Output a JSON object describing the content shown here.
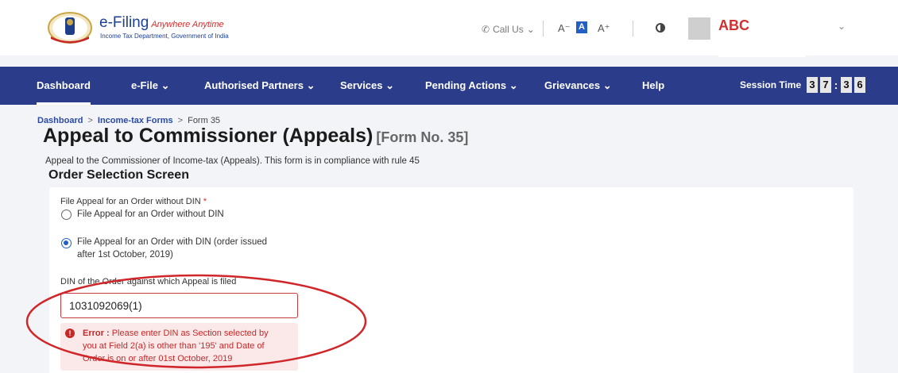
{
  "header": {
    "brand_title": "e-Filing",
    "brand_tagline": "Anywhere Anytime",
    "brand_subtitle": "Income Tax Department, Government of India",
    "call_us": "Call Us",
    "font_small": "A⁻",
    "font_normal": "A",
    "font_large": "A⁺",
    "username": "ABC"
  },
  "nav": {
    "items": [
      {
        "label": "Dashboard"
      },
      {
        "label": "e-File ⌄"
      },
      {
        "label": "Authorised Partners ⌄"
      },
      {
        "label": "Services ⌄"
      },
      {
        "label": "Pending Actions ⌄"
      },
      {
        "label": "Grievances ⌄"
      },
      {
        "label": "Help"
      }
    ],
    "session_label": "Session Time",
    "session_digits": [
      "3",
      "7",
      ":",
      "3",
      "6"
    ]
  },
  "breadcrumb": {
    "items": [
      "Dashboard",
      "Income-tax Forms",
      "Form 35"
    ]
  },
  "page": {
    "title": "Appeal to Commissioner (Appeals)",
    "form_no": "[Form No. 35]",
    "description": "Appeal to the Commissioner of Income-tax (Appeals). This form is in compliance with rule 45",
    "section_title": "Order Selection Screen"
  },
  "form": {
    "question_label": "File Appeal for an Order without DIN",
    "required_mark": "*",
    "option1": "File Appeal for an Order without DIN",
    "option2_line1": "File Appeal for an Order with DIN (order issued",
    "option2_line2": "after 1st October, 2019)",
    "selected_option": 2,
    "din_label": "DIN of the Order against which Appeal is filed",
    "din_value": "1031092069(1)",
    "error_prefix": "Error :",
    "error_line1": "Please enter DIN as Section selected by",
    "error_line2": "you at Field 2(a) is other than '195' and Date of",
    "error_line3": "Order is on or after 01st October, 2019"
  },
  "colors": {
    "nav_bg": "#2b3c8a",
    "error": "#c62828",
    "accent": "#2460c4",
    "annotation": "#d0262a"
  },
  "icons": {
    "phone": "phone-icon",
    "chevron": "chevron-down-icon",
    "contrast": "contrast-icon",
    "error": "error-icon",
    "emblem": "emblem-logo"
  }
}
